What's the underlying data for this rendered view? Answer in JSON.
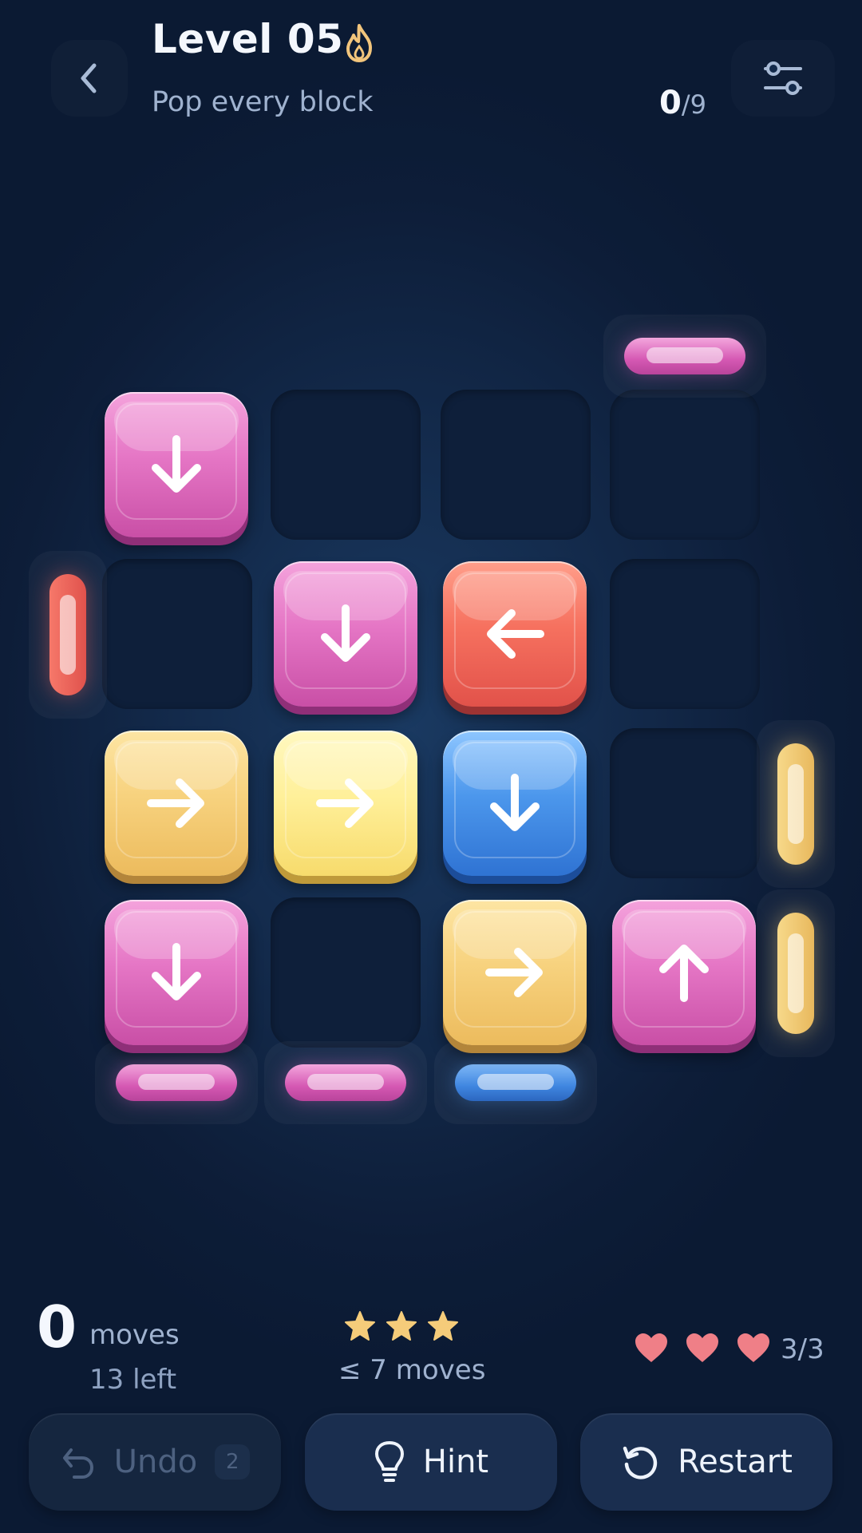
{
  "header": {
    "title": "Level 05",
    "subtitle": "Pop every block",
    "progress_current": "0",
    "progress_total": "/9",
    "icons": [
      "back-chevron-icon",
      "flame-icon",
      "settings-sliders-icon"
    ]
  },
  "board": {
    "rows": 4,
    "cols": 4,
    "blocks": [
      {
        "row": 1,
        "col": 1,
        "color": "pink",
        "arrow": "down"
      },
      {
        "row": 2,
        "col": 2,
        "color": "pink",
        "arrow": "down"
      },
      {
        "row": 2,
        "col": 3,
        "color": "coral",
        "arrow": "left"
      },
      {
        "row": 3,
        "col": 1,
        "color": "amber",
        "arrow": "right"
      },
      {
        "row": 3,
        "col": 2,
        "color": "yellow",
        "arrow": "right"
      },
      {
        "row": 3,
        "col": 3,
        "color": "blue",
        "arrow": "down"
      },
      {
        "row": 4,
        "col": 1,
        "color": "pink",
        "arrow": "down"
      },
      {
        "row": 4,
        "col": 3,
        "color": "amber",
        "arrow": "right"
      },
      {
        "row": 4,
        "col": 4,
        "color": "pink",
        "arrow": "up"
      }
    ],
    "exits": [
      {
        "side": "top",
        "col": 4,
        "color": "pink"
      },
      {
        "side": "left",
        "row": 2,
        "color": "coral"
      },
      {
        "side": "right",
        "row": 3,
        "color": "amber"
      },
      {
        "side": "right",
        "row": 4,
        "color": "amber"
      },
      {
        "side": "bottom",
        "col": 1,
        "color": "pink"
      },
      {
        "side": "bottom",
        "col": 2,
        "color": "pink"
      },
      {
        "side": "bottom",
        "col": 3,
        "color": "blue"
      }
    ],
    "colors": {
      "pink": "#e576c5",
      "coral": "#f6715f",
      "amber": "#f7d27e",
      "yellow": "#fff09a",
      "blue": "#4c97ec"
    }
  },
  "stats": {
    "moves_count": "0",
    "moves_label": "moves",
    "moves_left": "13 left",
    "stars": 3,
    "star_goal": "≤ 7 moves",
    "hearts": 3,
    "lives": "3/3"
  },
  "buttons": {
    "undo_label": "Undo",
    "undo_count": "2",
    "hint_label": "Hint",
    "restart_label": "Restart"
  }
}
